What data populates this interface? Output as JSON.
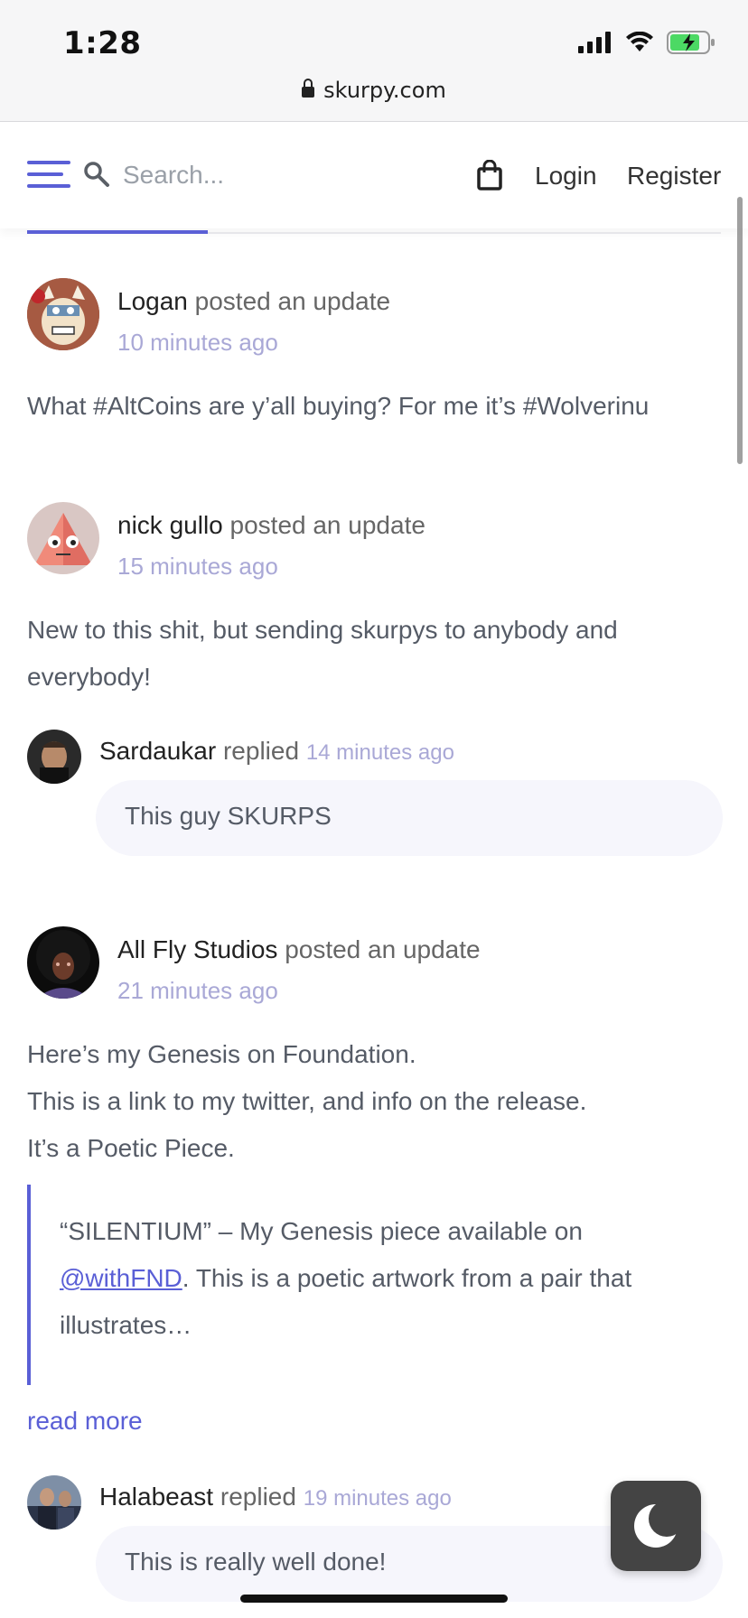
{
  "status_bar": {
    "time": "1:28",
    "url": "skurpy.com"
  },
  "header": {
    "search_placeholder": "Search...",
    "login_label": "Login",
    "register_label": "Register"
  },
  "feed": {
    "posts": [
      {
        "author": "Logan",
        "action": "posted an update",
        "time": "10 minutes ago",
        "text_lines": [
          "What #AltCoins are y’all buying? For me it’s #Wolverinu"
        ]
      },
      {
        "author": "nick gullo",
        "action": "posted an update",
        "time": "15 minutes ago",
        "text_lines": [
          "New to this shit, but sending skurpys to anybody and",
          "everybody!"
        ],
        "reply": {
          "author": "Sardaukar",
          "action": "replied",
          "time": "14 minutes ago",
          "text": "This guy SKURPS"
        }
      },
      {
        "author": "All Fly Studios",
        "action": "posted an update",
        "time": "21 minutes ago",
        "text_lines": [
          "Here’s my Genesis on Foundation.",
          "This is a link to my twitter, and info on the release.",
          "It’s a Poetic Piece."
        ],
        "quote": {
          "line1": "“SILENTIUM” – My Genesis piece available on",
          "link": "@withFND",
          "line2_rest": ". This is a poetic artwork from a pair that",
          "line3": "illustrates…"
        },
        "read_more": "read more",
        "reply": {
          "author": "Halabeast",
          "action": "replied",
          "time": "19 minutes ago",
          "text": "This is really well done!"
        }
      }
    ]
  },
  "colors": {
    "accent": "#5a5fd6",
    "time_text": "#a9a8d6",
    "bubble_bg": "#f6f6fc"
  },
  "icons": [
    "hamburger-menu-icon",
    "search-icon",
    "shopping-bag-icon",
    "moon-icon",
    "lock-icon",
    "signal-icon",
    "wifi-icon",
    "battery-icon"
  ]
}
